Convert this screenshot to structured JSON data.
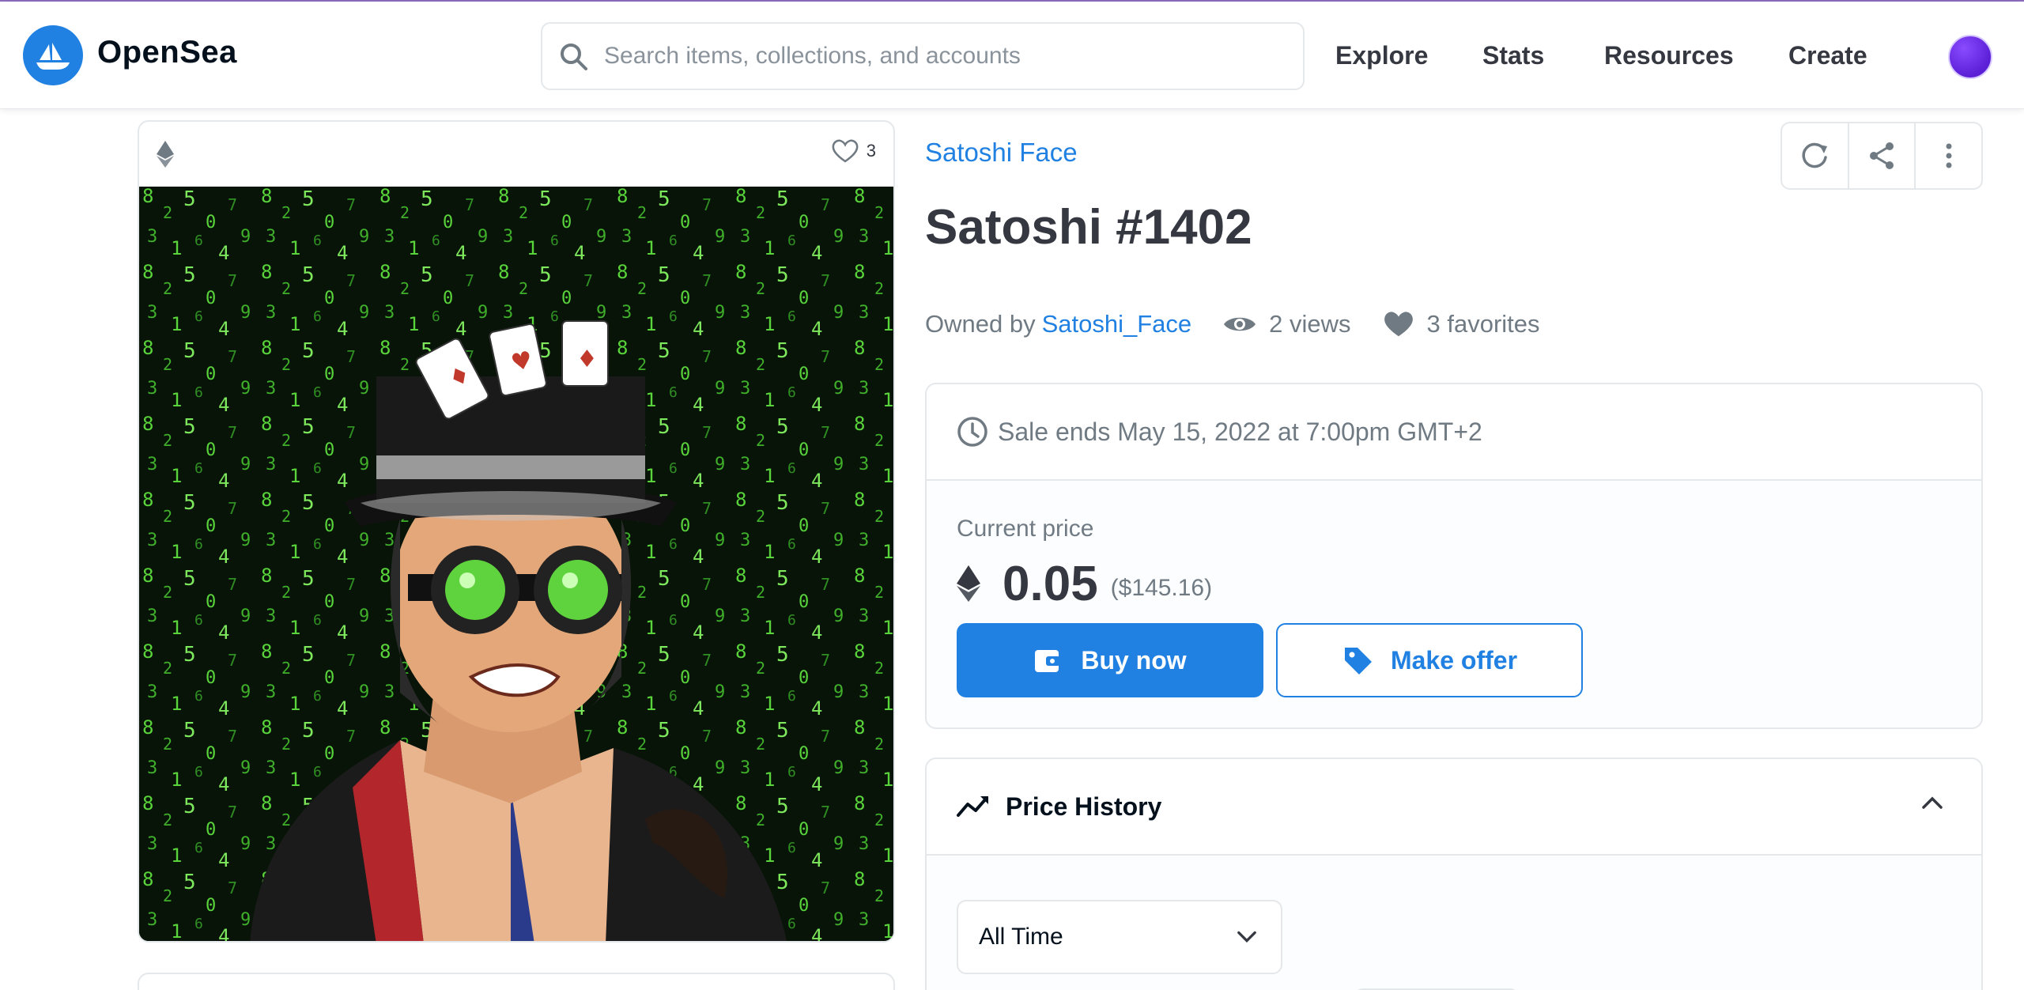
{
  "header": {
    "brand": "OpenSea",
    "search_placeholder": "Search items, collections, and accounts",
    "nav": [
      "Explore",
      "Stats",
      "Resources",
      "Create"
    ]
  },
  "media": {
    "favorites_count": "3"
  },
  "item": {
    "collection": "Satoshi Face",
    "title": "Satoshi #1402",
    "owned_by_label": "Owned by",
    "owner": "Satoshi_Face",
    "views": "2 views",
    "favorites": "3 favorites"
  },
  "sale": {
    "ends_text": "Sale ends May 15, 2022 at 7:00pm GMT+2",
    "current_price_label": "Current price",
    "price": "0.05",
    "price_usd": "($145.16)",
    "buy_label": "Buy now",
    "offer_label": "Make offer"
  },
  "price_history": {
    "title": "Price History",
    "range_selected": "All Time"
  },
  "colors": {
    "accent": "#2081e2",
    "text": "#353840",
    "muted": "#707a83",
    "border": "#e5e8eb",
    "matrix_green": "#59d43a"
  },
  "icons": [
    "search-icon",
    "ethereum-icon",
    "heart-icon",
    "refresh-icon",
    "share-icon",
    "more-vertical-icon",
    "eye-icon",
    "clock-icon",
    "wallet-icon",
    "tag-icon",
    "trend-line-icon",
    "chevron-up-icon",
    "chevron-down-icon"
  ]
}
